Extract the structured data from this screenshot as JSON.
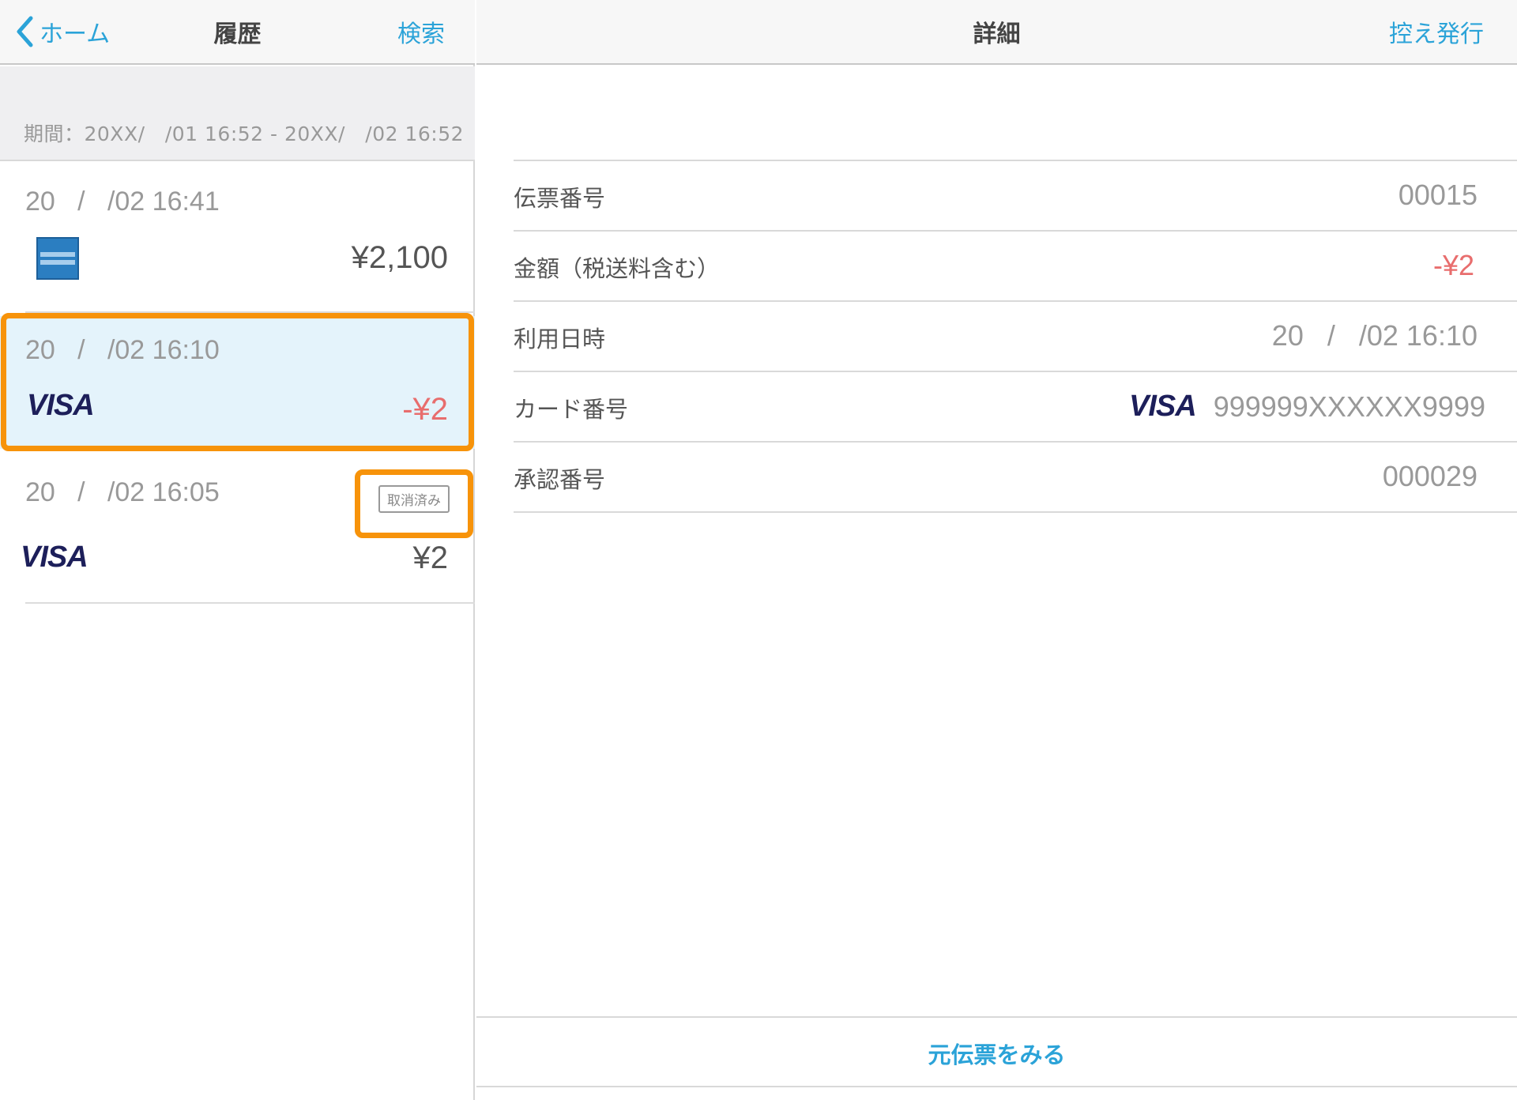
{
  "left_pane": {
    "back_label": "ホーム",
    "title": "履歴",
    "search_label": "検索",
    "period_text": "期間：20XX/   /01 16:52 - 20XX/   /02 16:52",
    "transactions": [
      {
        "date": "20   /   /02 16:41",
        "card_brand": "amex-icon",
        "amount": "¥2,100",
        "negative": false
      },
      {
        "date": "20   /   /02 16:10",
        "card_brand": "VISA",
        "amount": "-¥2",
        "negative": true,
        "selected": true
      },
      {
        "date": "20   /   /02 16:05",
        "card_brand": "VISA",
        "amount": "¥2",
        "negative": false,
        "badge": "取消済み"
      }
    ]
  },
  "right_pane": {
    "title": "詳細",
    "reissue_label": "控え発行",
    "details": {
      "slip_label": "伝票番号",
      "slip_value": "00015",
      "amount_label": "金額（税送料含む）",
      "amount_value": "-¥2",
      "date_label": "利用日時",
      "date_value": "20   /   /02 16:10",
      "card_label": "カード番号",
      "card_brand": "VISA",
      "card_value": "999999XXXXXX9999",
      "approval_label": "承認番号",
      "approval_value": "000029"
    },
    "view_original_label": "元伝票をみる"
  },
  "colors": {
    "accent": "#2ba3d8",
    "negative": "#e86d6d",
    "highlight": "#f7930a",
    "selected_row": "#e4f3fb",
    "visa": "#1d1f5a"
  }
}
